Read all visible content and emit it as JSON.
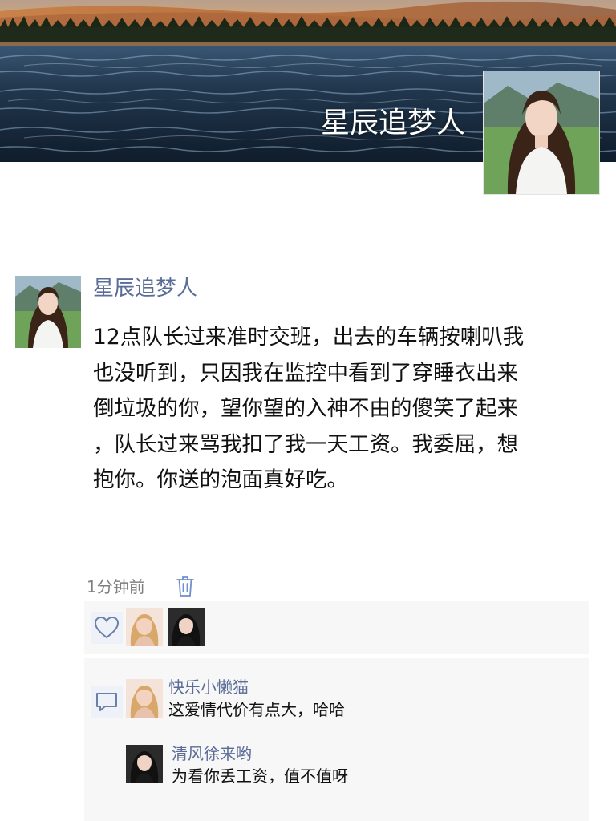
{
  "profile": {
    "cover_name": "星辰追梦人"
  },
  "post": {
    "author": "星辰追梦人",
    "body_lines": [
      "12点队长过来准时交班，出去的车辆按喇叭我",
      "也没听到，只因我在监控中看到了穿睡衣出来",
      "倒垃圾的你，望你望的入神不由的傻笑了起来",
      "，队长过来骂我扣了我一天工资。我委屈，想",
      "抱你。你送的泡面真好吃。"
    ],
    "time": "1分钟前"
  },
  "likes": {
    "icon": "heart-outline-icon"
  },
  "comments": [
    {
      "author": "快乐小懒猫",
      "text": "这爱情代价有点大，哈哈"
    },
    {
      "author": "清风徐来哟",
      "text": "为看你丢工资，值不值呀"
    }
  ],
  "colors": {
    "link_name": "#5b6c97",
    "accent_icon": "#6f8fcf",
    "box_background": "#f7f7f7",
    "meta_text": "#7d7d7d"
  }
}
